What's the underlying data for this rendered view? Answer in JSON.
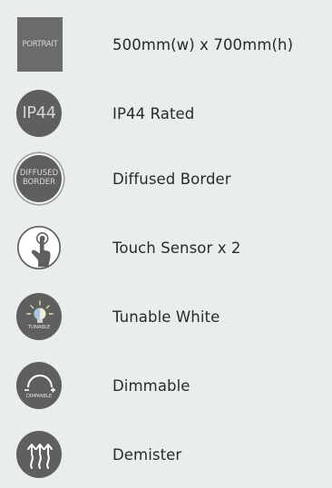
{
  "features": [
    {
      "icon": "portrait-icon",
      "icon_text": "PORTRAIT",
      "label": "500mm(w) x 700mm(h)"
    },
    {
      "icon": "ip44-icon",
      "icon_text": "IP44",
      "label": "IP44 Rated"
    },
    {
      "icon": "diffused-border-icon",
      "icon_text_1": "DIFFUSED",
      "icon_text_2": "BORDER",
      "label": "Diffused Border"
    },
    {
      "icon": "touch-sensor-icon",
      "label": "Touch Sensor x 2"
    },
    {
      "icon": "tunable-white-icon",
      "icon_text": "TUNABLE",
      "label": "Tunable White"
    },
    {
      "icon": "dimmable-icon",
      "icon_text": "DIMMABLE",
      "label": "Dimmable"
    },
    {
      "icon": "demister-icon",
      "label": "Demister"
    }
  ],
  "colors": {
    "background": "#e9eeeb",
    "icon_fill": "#5f5f5f",
    "text": "#2a2a2a"
  }
}
